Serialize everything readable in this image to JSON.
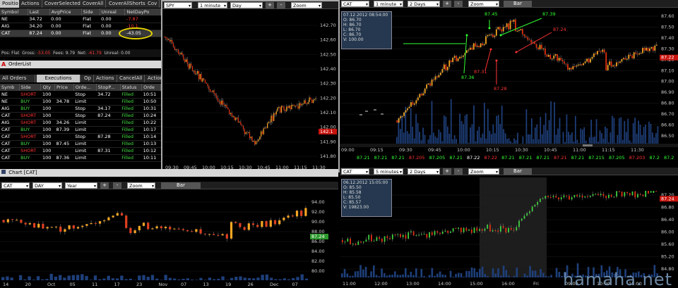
{
  "positions": {
    "tabs": [
      "Positio",
      "Actions",
      "CoverSelected",
      "CoverAll",
      "CoverAllShorts",
      "Cov"
    ],
    "columns": [
      "Symbol",
      "Last",
      "AvgPrice",
      "Side",
      "Unreal",
      "NetDayPo"
    ],
    "rows": [
      [
        "NE",
        "34.72",
        "0.00",
        "Flat",
        "0.00",
        "-7.87"
      ],
      [
        "AIG",
        "34.20",
        "0.00",
        "Flat",
        "0.00",
        "-10.1"
      ],
      [
        "CAT",
        "87.24",
        "0.00",
        "Flat",
        "0.00",
        "-43.05"
      ]
    ],
    "status": {
      "pos_label": "Pos:",
      "pos": "Flat",
      "gross_label": "Gross:",
      "gross": "-53.05",
      "fees_label": "Fees:",
      "fees": "9.79",
      "net_label": "Net:",
      "net": "-61.79",
      "unreal_label": "Unreal:",
      "unreal": "0.00"
    }
  },
  "orderlist": {
    "title": "OrderList",
    "tabs": [
      "All Orders",
      "Executions",
      "Op",
      "Actions",
      "CancelAll",
      "Actions"
    ],
    "columns": [
      "Symb",
      "Side",
      "Qty",
      "Price",
      "Orde...",
      "StopP...",
      "Status",
      "Orde"
    ],
    "rows": [
      [
        "NE",
        "SHORT",
        "100",
        "",
        "Stop",
        "34.72",
        "Filled",
        "10:51"
      ],
      [
        "NE",
        "BUY",
        "100",
        "34.78",
        "Limit",
        "",
        "Filled",
        "10:50"
      ],
      [
        "AIG",
        "BUY",
        "100",
        "",
        "Stop",
        "34.17",
        "Filled",
        "10:31"
      ],
      [
        "CAT",
        "SHORT",
        "100",
        "",
        "Stop",
        "87.24",
        "Filled",
        "10:24"
      ],
      [
        "AIG",
        "SHORT",
        "100",
        "34.26",
        "Limit",
        "",
        "Filled",
        "10:22"
      ],
      [
        "CAT",
        "BUY",
        "100",
        "87.39",
        "Limit",
        "",
        "Filled",
        "10:17"
      ],
      [
        "CAT",
        "SHORT",
        "100",
        "",
        "Stop",
        "87.28",
        "Filled",
        "10:14"
      ],
      [
        "CAT",
        "BUY",
        "100",
        "87.45",
        "Limit",
        "",
        "Filled",
        "10:13"
      ],
      [
        "CAT",
        "SHORT",
        "100",
        "",
        "Limit",
        "87.31",
        "Filled",
        "10:12"
      ],
      [
        "CAT",
        "BUY",
        "100",
        "87.36",
        "Limit",
        "",
        "Filled",
        "10:11"
      ]
    ]
  },
  "spy": {
    "symbol": "SPY",
    "interval": "1 minute",
    "range": "Day",
    "mode": "Zoom",
    "plus": "+",
    "minus": "-",
    "yticks": [
      "142.70",
      "142.60",
      "142.50",
      "142.40",
      "142.30",
      "142.20",
      "142.10",
      "142.00",
      "141.90",
      "141.80"
    ],
    "last": "142.1",
    "xticks": [
      "09:30",
      "09:45",
      "10:00",
      "10:15",
      "10:30",
      "10:45",
      "11:00",
      "11:15",
      "11:30"
    ]
  },
  "cat_intraday": {
    "symbol": "CAT",
    "interval": "1 minute",
    "range": "2 Days",
    "mode": "Zoom",
    "bar": "Bar",
    "plus": "+",
    "minus": "-",
    "ohlc": [
      "07.12.2012 08:54:00",
      "O: 86.70",
      "H: 86.70",
      "L: 86.70",
      "C: 86.70",
      "V: 100.00"
    ],
    "yticks": [
      "87.60",
      "87.50",
      "87.40",
      "87.30",
      "87.20",
      "87.10",
      "87.00",
      "86.90",
      "86.80",
      "86.70",
      "86.60",
      "86.50"
    ],
    "last": "87.22",
    "xticks": [
      "09:00",
      "09:15",
      "09:30",
      "09:45",
      "10:00",
      "10:15",
      "10:30",
      "10:45",
      "11:00",
      "11:15",
      "11:30"
    ],
    "annotations": [
      {
        "text": "87.45",
        "color": "#3f3"
      },
      {
        "text": "87.39",
        "color": "#3f3"
      },
      {
        "text": "87.24",
        "color": "#f33"
      },
      {
        "text": "87.31",
        "color": "#f33"
      },
      {
        "text": "87.36",
        "color": "#3f3"
      },
      {
        "text": "87.28",
        "color": "#f33"
      }
    ],
    "ticker": [
      "87.21",
      "87.21",
      "87.21",
      "87.205",
      "87.205",
      "87.21",
      "87.22",
      "87.22",
      "87.21",
      "87.21",
      "87.21",
      "87.21",
      "87.21",
      "87.215",
      "87.205",
      "87.203",
      "87.2",
      "87.2",
      "87.2"
    ]
  },
  "cat_year": {
    "title": "Chart [CAT]",
    "symbol": "CAT",
    "interval": "DAY",
    "range": "Year",
    "mode": "Zoom",
    "bar": "Bar",
    "plus": "+",
    "minus": "-",
    "yticks": [
      "94.00",
      "92.00",
      "90.00",
      "88.00",
      "86.00",
      "84.00",
      "82.00",
      "80.00"
    ],
    "last": "87.24",
    "xticks": [
      "14",
      "20",
      "Oct",
      "05",
      "11",
      "17",
      "23",
      "Nov",
      "07",
      "13",
      "19",
      "26",
      "Dec",
      "07"
    ]
  },
  "cat_5min": {
    "symbol": "CAT",
    "interval": "5 minutes",
    "range": "2 Days",
    "mode": "Zoom",
    "bar": "Bar",
    "plus": "+",
    "minus": "-",
    "ohlc": [
      "06.12.2012 15:05:00",
      "O: 85.50",
      "H: 85.58",
      "L: 85.50",
      "C: 85.57",
      "V: 19823.00"
    ],
    "yticks": [
      "87.20",
      "86.80",
      "86.40",
      "86.00",
      "85.60",
      "85.20",
      "84.80"
    ],
    "last": "87.24",
    "xticks": [
      "11:00",
      "12:00",
      "13:00",
      "14:00",
      "15:00",
      "16:00",
      "Fri",
      "09:00",
      "10:00",
      "11:00"
    ]
  },
  "watermark": "hamaha.net",
  "colors": {
    "up": "#f5a623",
    "down": "#e03010",
    "green": "#3f3",
    "red": "#f33",
    "last": "#c8140e",
    "volume": "#1e3f7a"
  }
}
